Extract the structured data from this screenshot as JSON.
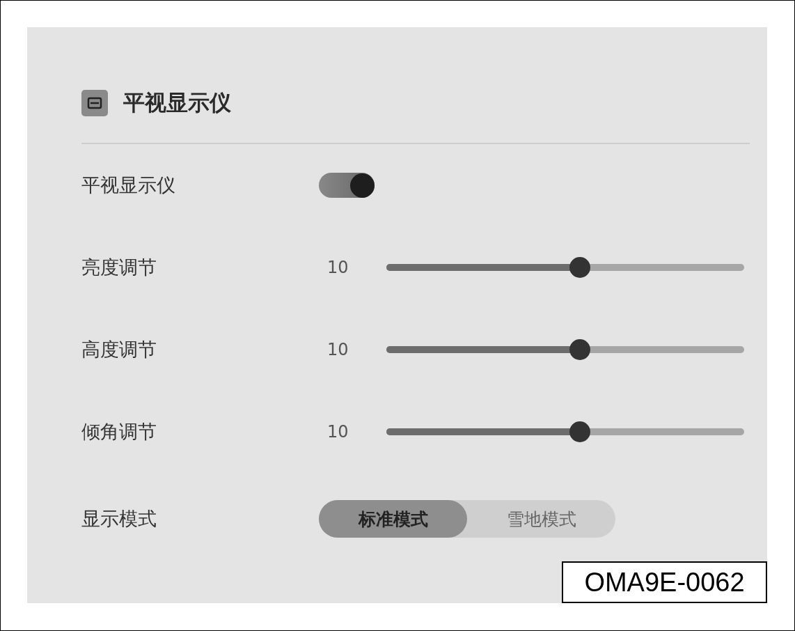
{
  "header": {
    "title": "平视显示仪"
  },
  "settings": [
    {
      "kind": "toggle",
      "label": "平视显示仪",
      "on": true
    },
    {
      "kind": "slider",
      "label": "亮度调节",
      "value": "10",
      "level": 0.54
    },
    {
      "kind": "slider",
      "label": "高度调节",
      "value": "10",
      "level": 0.54
    },
    {
      "kind": "slider",
      "label": "倾角调节",
      "value": "10",
      "level": 0.54
    },
    {
      "kind": "segmented",
      "label": "显示模式",
      "options": [
        {
          "label": "标准模式",
          "selected": true
        },
        {
          "label": "雪地模式",
          "selected": false
        }
      ]
    }
  ],
  "figure_code": "OMA9E-0062"
}
